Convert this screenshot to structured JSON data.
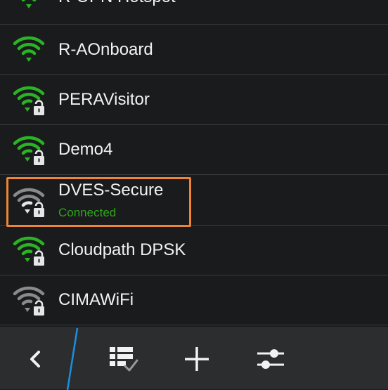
{
  "networks": [
    {
      "name": "R-OPN Hotspot",
      "secured": false,
      "signal_color": "#29b523"
    },
    {
      "name": "R-AOnboard",
      "secured": false,
      "signal_color": "#29b523"
    },
    {
      "name": "PERAVisitor",
      "secured": true,
      "signal_color": "#29b523"
    },
    {
      "name": "Demo4",
      "secured": true,
      "signal_color": "#29b523"
    },
    {
      "name": "DVES-Secure",
      "secured": true,
      "signal_color": "#8a8a8a",
      "status": "Connected"
    },
    {
      "name": "Cloudpath DPSK",
      "secured": true,
      "signal_color": "#29b523"
    },
    {
      "name": "CIMAWiFi",
      "secured": true,
      "signal_color": "#8a8a8a"
    }
  ],
  "colors": {
    "background": "#1a1b1c",
    "connected_text": "#2fa51b",
    "highlight": "#ee8434",
    "toolbar": "#2c2d2f",
    "accent_divider": "#1a8fe0"
  },
  "toolbar": {
    "back_icon": "chevron-left-icon",
    "list_icon": "checklist-icon",
    "add_icon": "plus-icon",
    "settings_icon": "sliders-icon"
  }
}
